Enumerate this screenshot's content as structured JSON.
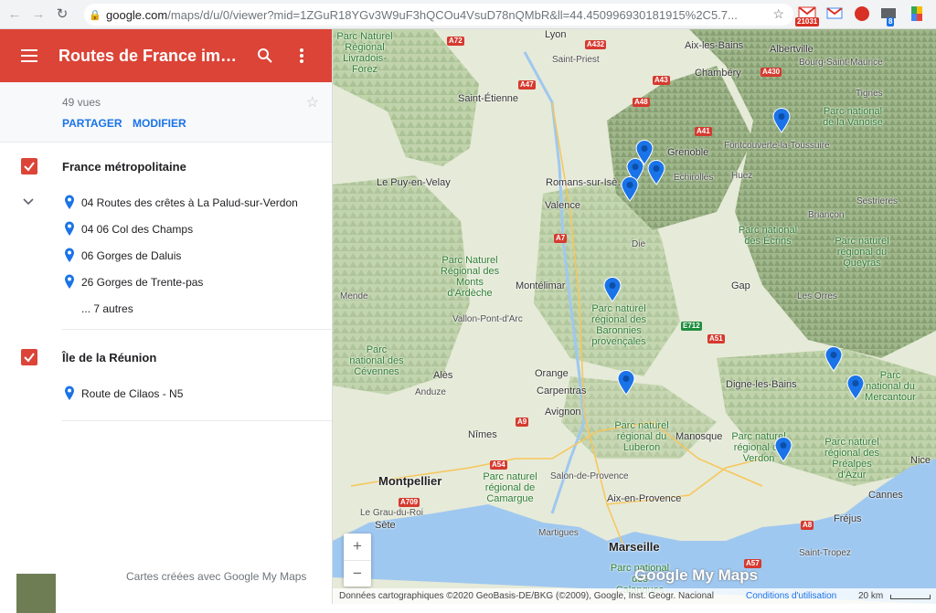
{
  "browser": {
    "url_host": "google.com",
    "url_path": "/maps/d/u/0/viewer?mid=1ZGuR18YGv3W9uF3hQCOu4VsuD78nQMbR&ll=44.450996930181915%2C5.7...",
    "ext_badge_1": "21031",
    "ext_badge_2": "8"
  },
  "panel": {
    "title": "Routes de France impre…",
    "views": "49 vues",
    "share": "PARTAGER",
    "edit": "MODIFIER",
    "footer": "Cartes créées avec Google My Maps"
  },
  "layers": [
    {
      "name": "France métropolitaine",
      "items": [
        "04 Routes des crêtes à La Palud-sur-Verdon",
        "04 06 Col des Champs",
        "06 Gorges de Daluis",
        "26 Gorges de Trente-pas"
      ],
      "more": "... 7 autres"
    },
    {
      "name": "Île de la Réunion",
      "items": [
        "Route de Cilaos - N5"
      ]
    }
  ],
  "map": {
    "labels": {
      "lyon": "Lyon",
      "aix_bains": "Aix-les-Bains",
      "albertville": "Albertville",
      "bourg": "Bourg-Saint-Maurice",
      "chambery": "Chambéry",
      "st_priest": "Saint-Priest",
      "st_etienne": "Saint-Étienne",
      "grenoble": "Grenoble",
      "echirolles": "Échirolles",
      "puy": "Le Puy-en-Velay",
      "romans": "Romans-sur-Isè…",
      "valence": "Valence",
      "die": "Die",
      "montelimar": "Montélimar",
      "mende": "Mende",
      "vallon": "Vallon-Pont-d'Arc",
      "ales": "Alès",
      "orange": "Orange",
      "carpentras": "Carpentras",
      "avignon": "Avignon",
      "nimes": "Nîmes",
      "montpellier": "Montpellier",
      "sete": "Sète",
      "grau": "Le Grau-du-Roi",
      "salon": "Salon-de-Provence",
      "aix": "Aix-en-Provence",
      "martigues": "Martigues",
      "marseille": "Marseille",
      "manosque": "Manosque",
      "digne": "Digne-les-Bains",
      "gap": "Gap",
      "les_orres": "Les Orres",
      "briancon": "Briançon",
      "fontcouverte": "Fontcouverte-la-Toussuire",
      "sestrieres": "Sestrieres",
      "nice": "Nice",
      "cannes": "Cannes",
      "frejus": "Fréjus",
      "st_tropez": "Saint-Tropez",
      "anduze": "Anduze",
      "huez": "Huez",
      "tignes": "Tignes"
    },
    "parks": {
      "livradois": "Parc Naturel Régional Livradois-Forez",
      "vanoise": "Parc national de la Vanoise",
      "ecrins": "Parc national des Écrins",
      "queyras": "Parc naturel régional du Queyras",
      "ardeche": "Parc Naturel Régional des Monts d'Ardèche",
      "baronnies": "Parc naturel régional des Baronnies provençales",
      "cevennes": "Parc national des Cévennes",
      "mercantour": "Parc national du Mercantour",
      "luberon": "Parc naturel régional du Luberon",
      "verdon": "Parc naturel régional du Verdon",
      "prealpes": "Parc naturel régional des Préalpes d'Azur",
      "camargue": "Parc naturel régional de Camargue",
      "calanques": "Parc national des Calanques"
    },
    "roads": [
      "A72",
      "A432",
      "A43",
      "A430",
      "A47",
      "A48",
      "A41",
      "A7",
      "A9",
      "A54",
      "A709",
      "A51",
      "E712",
      "A8",
      "A57"
    ],
    "zoom_in": "+",
    "zoom_out": "−",
    "watermark": "Google My Maps",
    "attribution": "Données cartographiques ©2020 GeoBasis-DE/BKG (©2009), Google, Inst. Geogr. Nacional",
    "terms": "Conditions d'utilisation",
    "scale": "20 km",
    "colors": {
      "header": "#db4437",
      "pin": "#1a73e8",
      "sea": "#9fc8f0",
      "land": "#e8ecd9"
    }
  }
}
